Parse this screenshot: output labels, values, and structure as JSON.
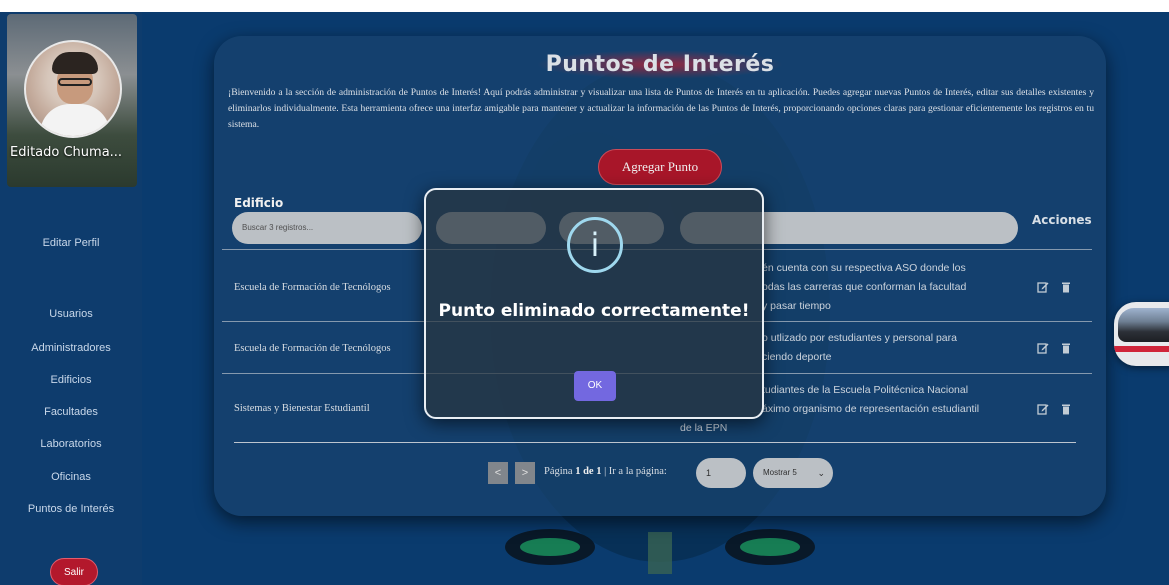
{
  "sidebar": {
    "profile_name": "Editado Chuma...",
    "items": [
      {
        "label": "Editar Perfil"
      },
      {
        "label": "Usuarios"
      },
      {
        "label": "Administradores"
      },
      {
        "label": "Edificios"
      },
      {
        "label": "Facultades"
      },
      {
        "label": "Laboratorios"
      },
      {
        "label": "Oficinas"
      },
      {
        "label": "Puntos de Interés"
      }
    ],
    "logout_label": "Salir"
  },
  "main": {
    "title": "Puntos de Interés",
    "intro": "¡Bienvenido a la sección de administración de Puntos de Interés! Aquí podrás administrar y visualizar una lista de Puntos de Interés en tu aplicación. Puedes agregar nuevas Puntos de Interés, editar sus detalles existentes y eliminarlos individualmente. Esta herramienta ofrece una interfaz amigable para mantener y actualizar la información de las Puntos de Interés, proporcionando opciones claras para gestionar eficientemente los registros en tu sistema.",
    "add_button": "Agregar Punto",
    "table": {
      "header_edificio": "Edificio",
      "header_acciones": "Acciones",
      "filter_placeholder": "Buscar 3 registros...",
      "rows": [
        {
          "edificio": "Escuela de Formación de Tecnólogos",
          "desc1": "én cuenta con su respectiva ASO donde los",
          "desc2": "odas las carreras que conforman la facultad",
          "desc3": "y pasar tiempo"
        },
        {
          "edificio": "Escuela de Formación de Tecnólogos",
          "desc1": "o utlizado por estudiantes y personal para",
          "desc2": "ciendo deporte",
          "desc3": ""
        },
        {
          "edificio": "Sistemas y Bienestar Estudiantil",
          "desc1": "tudiantes de la Escuela Politécnica Nacional",
          "desc2": "áximo organismo de representación estudiantil",
          "desc3": "de la EPN"
        }
      ]
    },
    "pagination": {
      "prev": "<",
      "next": ">",
      "page_word": "Página",
      "page_current": "1",
      "page_of": "de",
      "page_total": "1",
      "goto_label": "| Ir a la página:",
      "goto_value": "1",
      "show_select": "Mostrar 5"
    }
  },
  "modal": {
    "icon": "i",
    "message": "Punto eliminado correctamente!",
    "ok_label": "OK"
  },
  "colors": {
    "background": "#0b3f75",
    "accent_red": "#b3182c",
    "ok_purple": "#7368e0",
    "info_icon": "#9fd8ee"
  }
}
